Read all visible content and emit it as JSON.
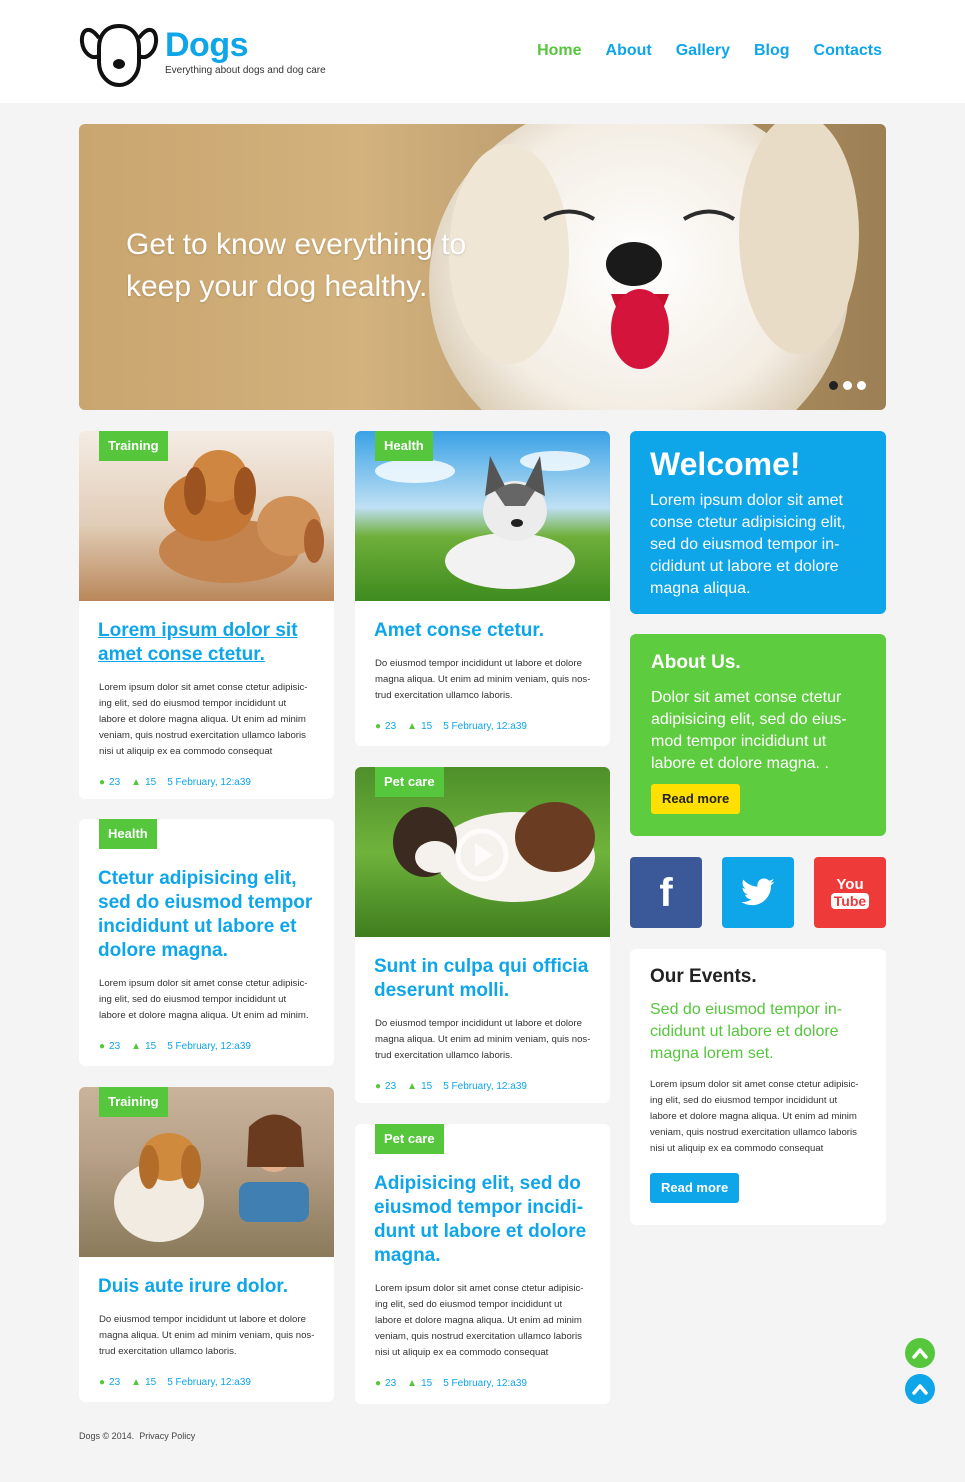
{
  "header": {
    "brand": "Dogs",
    "tagline": "Everything about dogs and dog care",
    "nav": [
      "Home",
      "About",
      "Gallery",
      "Blog",
      "Contacts"
    ],
    "active_nav": "Home"
  },
  "hero": {
    "text": "Get to know everything to keep your dog healthy.",
    "slide_count": 3,
    "active_slide": 1
  },
  "posts": {
    "p1": {
      "tag": "Training",
      "title": "Lorem ipsum dolor sit amet conse ctetur.",
      "text": "Lorem ipsum dolor sit amet conse ctetur adipisic-ing elit, sed do eiusmod tempor incididunt ut labore et dolore magna aliqua. Ut enim ad minim veniam, quis nostrud exercitation ullamco laboris nisi ut aliquip ex ea commodo consequat",
      "comments": "23",
      "likes": "15",
      "date": "5 February, 12:a39"
    },
    "p2": {
      "tag": "Health",
      "title": "Amet conse ctetur.",
      "text": "Do eiusmod tempor incididunt ut labore et dolore magna aliqua. Ut enim ad minim veniam, quis nos-trud exercitation ullamco laboris.",
      "comments": "23",
      "likes": "15",
      "date": "5 February, 12:a39"
    },
    "p3": {
      "tag": "Health",
      "title": "Ctetur adipisicing elit, sed do eiusmod tempor incididunt ut labore et dolore magna.",
      "text": "Lorem ipsum dolor sit amet conse ctetur adipisic-ing elit, sed do eiusmod tempor incididunt ut labore et dolore magna aliqua. Ut enim ad minim.",
      "comments": "23",
      "likes": "15",
      "date": "5 February, 12:a39"
    },
    "p4": {
      "tag": "Pet care",
      "title": "Sunt in culpa qui officia deserunt molli.",
      "text": "Do eiusmod tempor incididunt ut labore et dolore magna aliqua. Ut enim ad minim veniam, quis nos-trud exercitation ullamco laboris.",
      "comments": "23",
      "likes": "15",
      "date": "5 February, 12:a39"
    },
    "p5": {
      "tag": "Training",
      "title": "Duis aute irure dolor.",
      "text": "Do eiusmod tempor incididunt ut labore et dolore magna aliqua. Ut enim ad minim veniam, quis nos-trud exercitation ullamco laboris.",
      "comments": "23",
      "likes": "15",
      "date": "5 February, 12:a39"
    },
    "p6": {
      "tag": "Pet care",
      "title": "Adipisicing elit, sed do eiusmod tempor incidi-dunt ut labore et dolore magna.",
      "text": "Lorem ipsum dolor sit amet conse ctetur adipisic-ing elit, sed do eiusmod tempor incididunt ut labore et dolore magna aliqua. Ut enim ad minim veniam, quis nostrud exercitation ullamco laboris nisi ut aliquip ex ea commodo consequat",
      "comments": "23",
      "likes": "15",
      "date": "5 February, 12:a39"
    }
  },
  "welcome": {
    "title": "Welcome!",
    "text": "Lorem ipsum dolor sit amet conse ctetur adipisicing elit, sed do eiusmod tempor in-cididunt ut labore et dolore magna aliqua."
  },
  "about": {
    "title": "About Us.",
    "text": "Dolor sit amet conse ctetur adipisicing elit, sed do eius-mod tempor incididunt ut labore et dolore magna. .",
    "button": "Read more"
  },
  "social": {
    "facebook": "f",
    "youtube_top": "You",
    "youtube_bottom": "Tube"
  },
  "events": {
    "title": "Our Events.",
    "lead": "Sed do eiusmod tempor in-cididunt ut labore et dolore magna lorem set.",
    "text": "Lorem ipsum dolor sit amet conse ctetur adipisic-ing elit, sed do eiusmod tempor incididunt ut labore et dolore magna aliqua. Ut enim ad minim veniam, quis nostrud exercitation ullamco laboris nisi ut aliquip ex ea commodo consequat",
    "button": "Read more"
  },
  "footer": {
    "copyright": "Dogs © 2014.",
    "privacy": "Privacy Policy"
  },
  "colors": {
    "blue": "#0ea5e9",
    "green": "#56c63d",
    "yellow": "#ffe000",
    "facebook": "#3b5998",
    "youtube": "#ef3a3a"
  }
}
